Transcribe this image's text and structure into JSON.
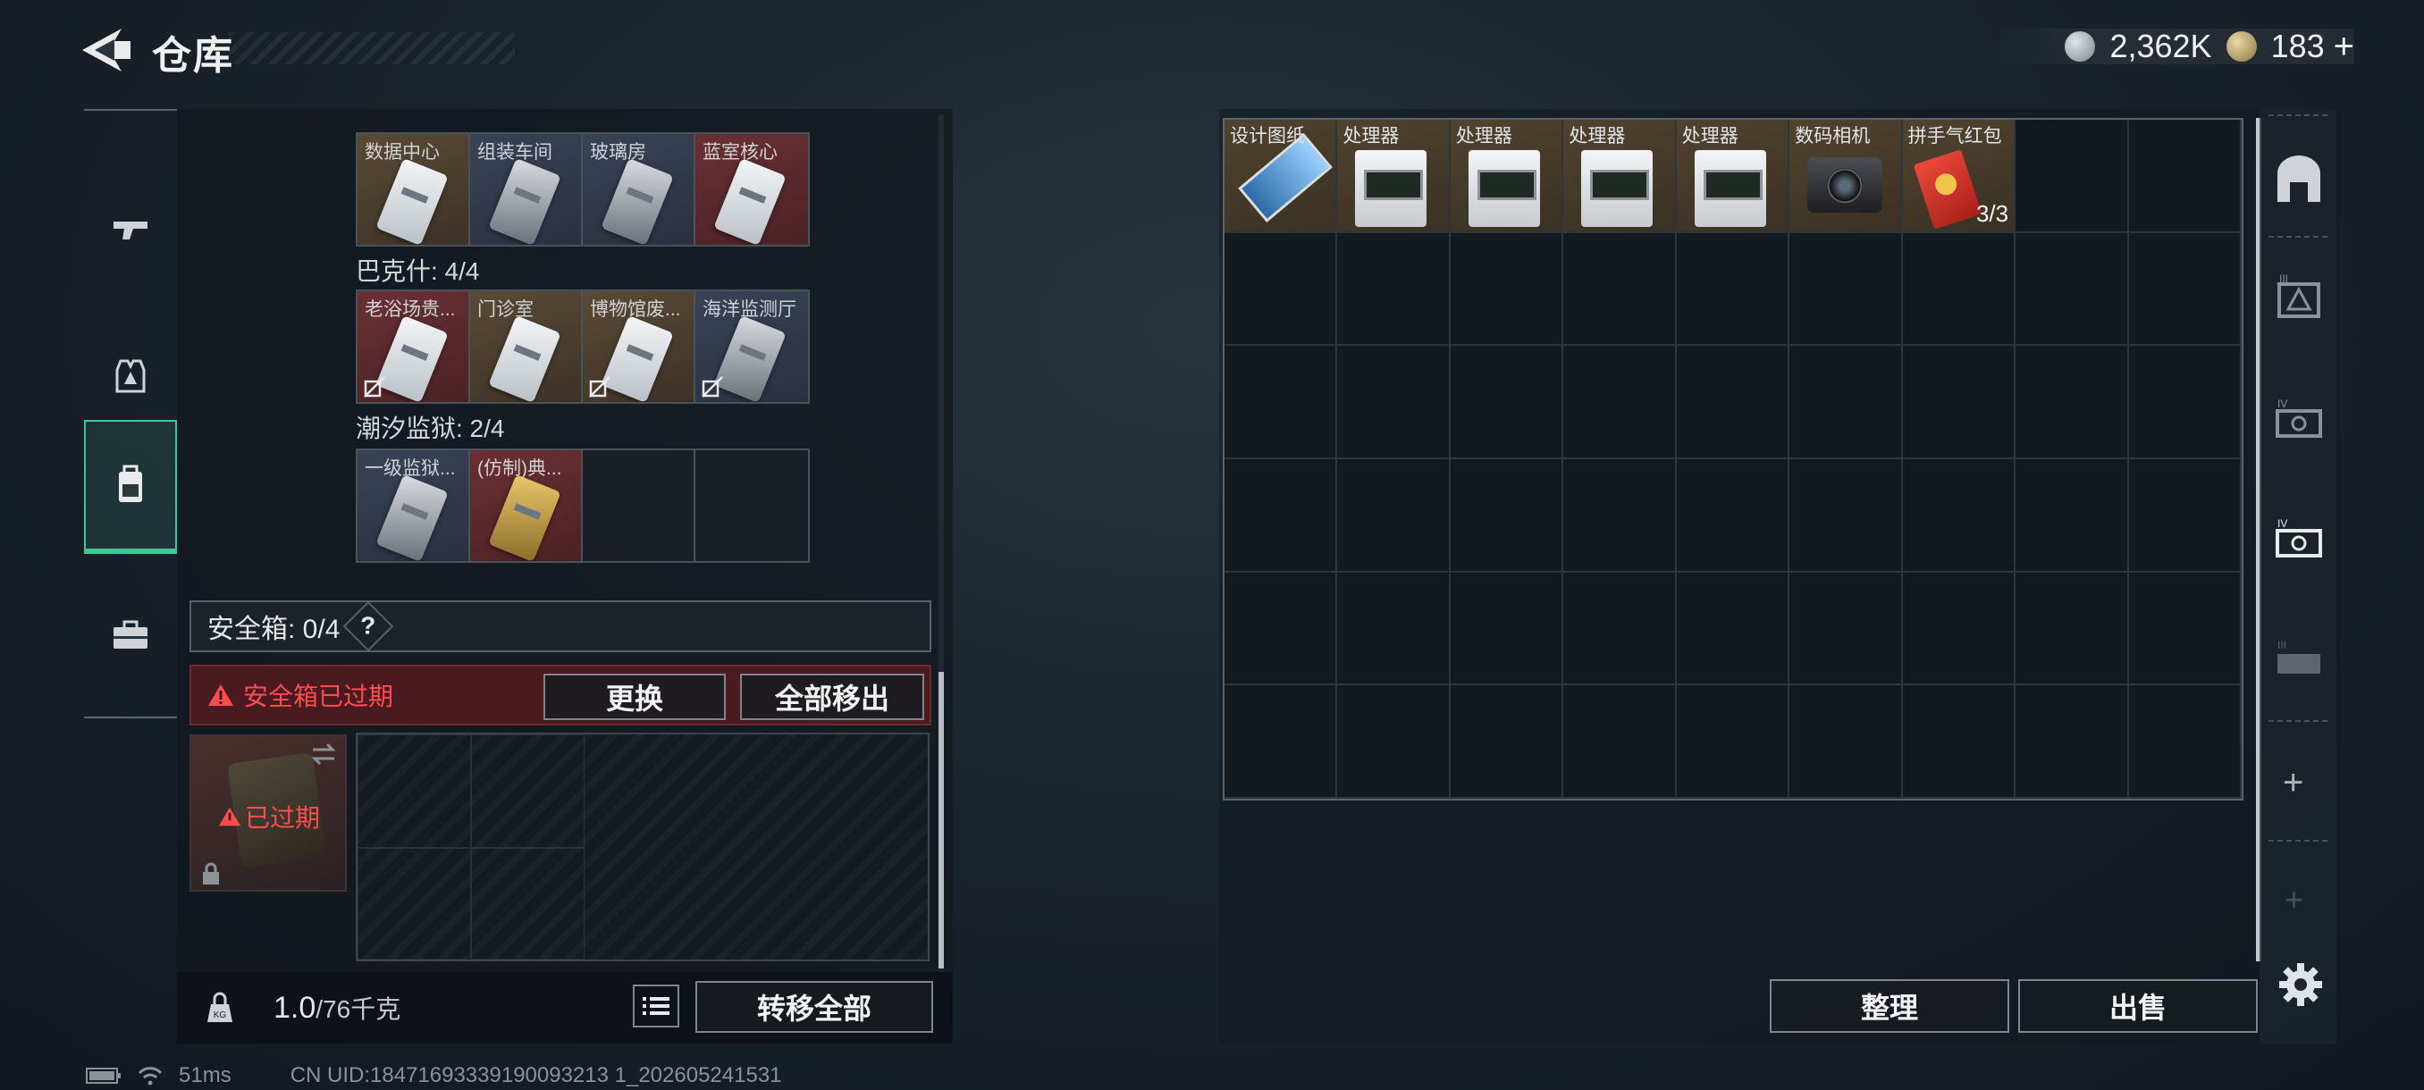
{
  "header": {
    "title": "仓库"
  },
  "currency": [
    {
      "icon": "silver-coin-icon",
      "value": "2,362K"
    },
    {
      "icon": "gold-coin-icon",
      "value": "183"
    }
  ],
  "header_plus": "+",
  "left_tabs": [
    {
      "name": "weapon-tab",
      "icon": "gun-icon"
    },
    {
      "name": "armor-tab",
      "icon": "vest-icon"
    },
    {
      "name": "backpack-tab",
      "icon": "backpack-icon",
      "active": true
    },
    {
      "name": "case-tab",
      "icon": "briefcase-icon"
    }
  ],
  "keycard_sections": [
    {
      "title": "",
      "cards": [
        {
          "label": "数据中心",
          "color": "brown",
          "nodrop": false
        },
        {
          "label": "组装车间",
          "color": "blue",
          "nodrop": false
        },
        {
          "label": "玻璃房",
          "color": "blue",
          "nodrop": false
        },
        {
          "label": "蓝室核心",
          "color": "red",
          "nodrop": false
        }
      ]
    },
    {
      "title": "巴克什: 4/4",
      "cards": [
        {
          "label": "老浴场贵...",
          "color": "red",
          "nodrop": true
        },
        {
          "label": "门诊室",
          "color": "brown",
          "nodrop": false
        },
        {
          "label": "博物馆废...",
          "color": "brown",
          "nodrop": true
        },
        {
          "label": "海洋监测厅",
          "color": "blue",
          "nodrop": true
        }
      ]
    },
    {
      "title": "潮汐监狱: 2/4",
      "cards": [
        {
          "label": "一级监狱...",
          "color": "blue",
          "nodrop": false
        },
        {
          "label": "(仿制)典...",
          "color": "red",
          "nodrop": false,
          "gold": true
        },
        {
          "label": "",
          "color": "empty"
        },
        {
          "label": "",
          "color": "empty"
        }
      ]
    }
  ],
  "safe_box": {
    "title": "安全箱:  0/4",
    "help": "?",
    "expired_notice": "安全箱已过期",
    "replace_button": "更换",
    "remove_all_button": "全部移出",
    "expired_badge": "已过期"
  },
  "bottom": {
    "weight_current": "1.0",
    "weight_max": "/76千克",
    "transfer_all_button": "转移全部"
  },
  "stash_items": [
    {
      "label": "设计图纸",
      "kind": "blueprint",
      "count": ""
    },
    {
      "label": "处理器",
      "kind": "processor",
      "count": ""
    },
    {
      "label": "处理器",
      "kind": "processor",
      "count": ""
    },
    {
      "label": "处理器",
      "kind": "processor",
      "count": ""
    },
    {
      "label": "处理器",
      "kind": "processor",
      "count": ""
    },
    {
      "label": "数码相机",
      "kind": "camera",
      "count": ""
    },
    {
      "label": "拼手气红包",
      "kind": "redpacket",
      "count": "3/3"
    }
  ],
  "stash_buttons": {
    "sort": "整理",
    "sell": "出售"
  },
  "right_rail_plus": "+",
  "status": {
    "ping": "51ms",
    "uid": "CN UID:18471693339190093213 1_202605241531"
  }
}
